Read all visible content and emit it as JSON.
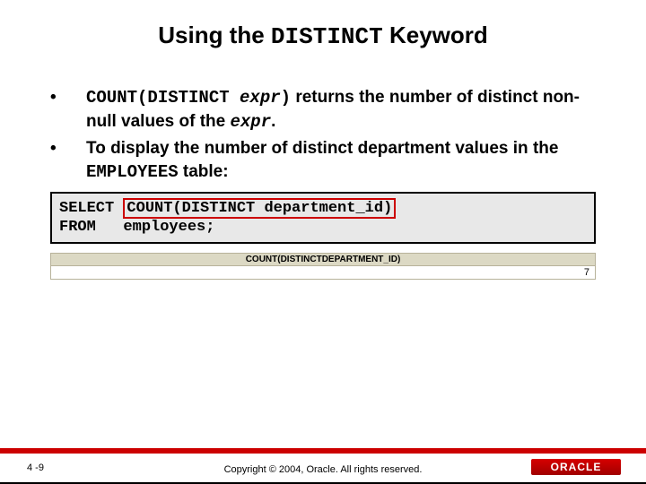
{
  "title": {
    "pre": "Using the ",
    "mono": "DISTINCT",
    "post": " Keyword"
  },
  "bullets": [
    {
      "parts": {
        "a_mono": "COUNT(DISTINCT ",
        "b_monoi": "expr",
        "c_mono": ")",
        "d": " returns the number of distinct non-null values of the ",
        "e_monoi": "expr",
        "f": "."
      }
    },
    {
      "parts": {
        "a": "To display the number of distinct department values in the ",
        "b_mono": "EMPLOYEES",
        "c": " table:"
      }
    }
  ],
  "code": {
    "kw_select": "SELECT ",
    "highlight": "COUNT(DISTINCT department_id)",
    "line2": "FROM   employees;"
  },
  "result": {
    "header": "COUNT(DISTINCTDEPARTMENT_ID)",
    "value": "7"
  },
  "footer": {
    "slideno": "4 -9",
    "copyright": "Copyright © 2004, Oracle.  All rights reserved.",
    "logo": "ORACLE"
  },
  "chart_data": {
    "type": "table",
    "columns": [
      "COUNT(DISTINCTDEPARTMENT_ID)"
    ],
    "rows": [
      [
        7
      ]
    ]
  }
}
